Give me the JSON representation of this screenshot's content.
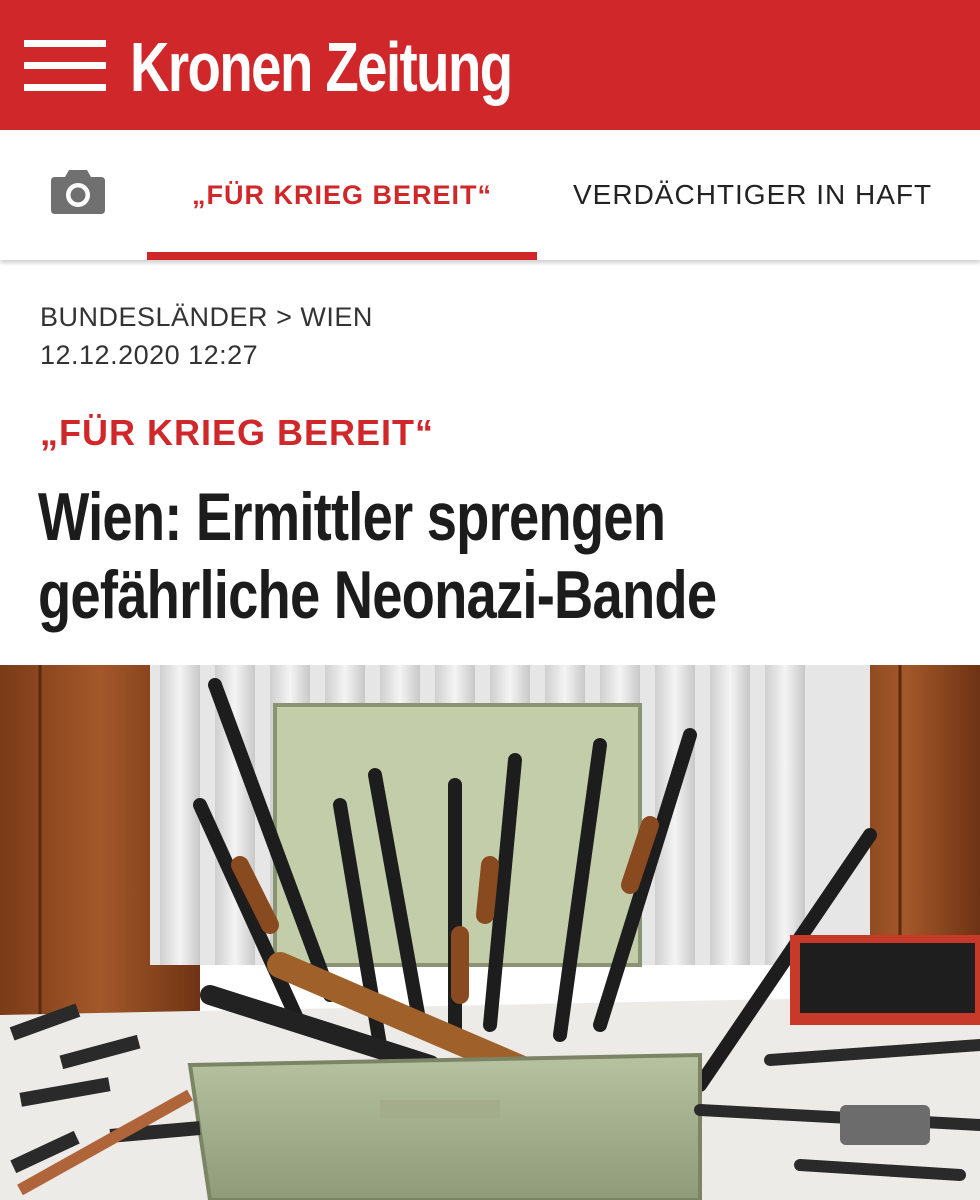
{
  "header": {
    "menu_icon": "hamburger-menu-icon",
    "logo": "Kronen Zeitung",
    "background": "#d0282a"
  },
  "tabs": {
    "gallery_icon": "camera-icon",
    "items": [
      {
        "label": "„FÜR KRIEG BEREIT“",
        "active": true
      },
      {
        "label": "VERDÄCHTIGER IN HAFT",
        "active": false
      }
    ]
  },
  "article": {
    "breadcrumb": {
      "section": "BUNDESLÄNDER",
      "separator": ">",
      "subsection": "WIEN"
    },
    "date": "12.12.2020 12:27",
    "kicker": "„FÜR KRIEG BEREIT“",
    "headline": "Wien: Ermittler sprengen gefährliche Neonazi-Bande"
  },
  "colors": {
    "accent": "#d0282a",
    "text": "#1c1c1c"
  }
}
